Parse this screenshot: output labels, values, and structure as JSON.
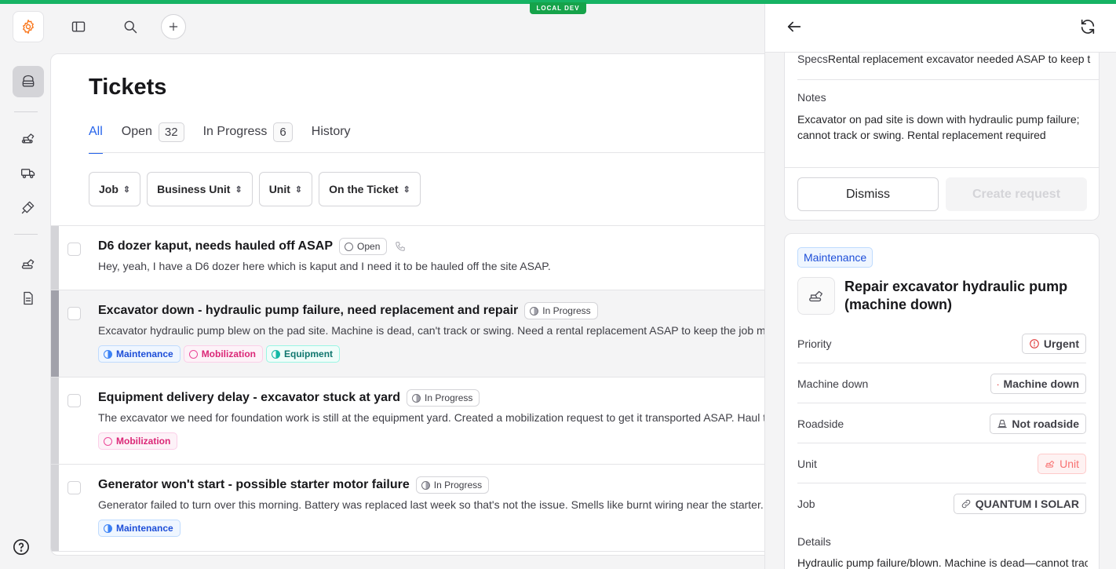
{
  "env_badge": "LOCAL DEV",
  "page": {
    "title": "Tickets",
    "tabs": [
      {
        "label": "All",
        "count": null
      },
      {
        "label": "Open",
        "count": "32"
      },
      {
        "label": "In Progress",
        "count": "6"
      },
      {
        "label": "History",
        "count": null
      }
    ],
    "filters": [
      "Job",
      "Business Unit",
      "Unit",
      "On the Ticket"
    ]
  },
  "tickets": [
    {
      "title": "D6 dozer kaput, needs hauled off ASAP",
      "status": "Open",
      "description": "Hey, yeah, I have a D6 dozer here which is kaput and I need it to be hauled off the site ASAP.",
      "tags": []
    },
    {
      "title": "Excavator down - hydraulic pump failure, need replacement and repair",
      "status": "In Progress",
      "description": "Excavator hydraulic pump blew on the pad site. Machine is dead, can't track or swing. Need a rental replacement ASAP to keep the job moving.",
      "tags": [
        "Maintenance",
        "Mobilization",
        "Equipment"
      ]
    },
    {
      "title": "Equipment delivery delay - excavator stuck at yard",
      "status": "In Progress",
      "description": "The excavator we need for foundation work is still at the equipment yard. Created a mobilization request to get it transported ASAP. Haul truck needed.",
      "tags": [
        "Mobilization"
      ]
    },
    {
      "title": "Generator won't start - possible starter motor failure",
      "status": "In Progress",
      "description": "Generator failed to turn over this morning. Battery was replaced last week so that's not the issue. Smells like burnt wiring near the starter.",
      "tags": [
        "Maintenance"
      ]
    }
  ],
  "panel": {
    "card1": {
      "specs_label": "Specs",
      "specs_value": "Rental replacement excavator needed ASAP to keep the job moving",
      "notes_label": "Notes",
      "notes_value": "Excavator on pad site is down with hydraulic pump failure; cannot track or swing. Rental replacement required",
      "dismiss": "Dismiss",
      "create": "Create request"
    },
    "card2": {
      "category": "Maintenance",
      "title": "Repair excavator hydraulic pump (machine down)",
      "priority_label": "Priority",
      "priority_value": "Urgent",
      "machine_down_label": "Machine down",
      "machine_down_value": "Machine down",
      "roadside_label": "Roadside",
      "roadside_value": "Not roadside",
      "unit_label": "Unit",
      "unit_value": "Unit",
      "job_label": "Job",
      "job_value": "QUANTUM I SOLAR",
      "details_label": "Details",
      "details_value": "Hydraulic pump failure/blown. Machine is dead—cannot track or swing"
    }
  },
  "colors": {
    "accent": "#2563eb",
    "env": "#16a34a",
    "brand": "#f97316",
    "urgent": "#dc2626"
  }
}
